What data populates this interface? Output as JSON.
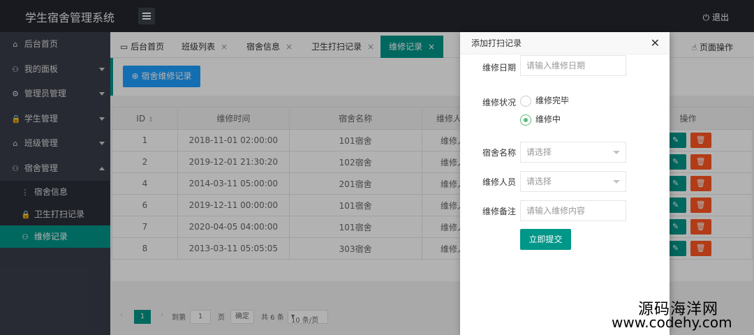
{
  "header": {
    "title": "学生宿舍管理系统",
    "logout": "退出"
  },
  "sidebar": {
    "items": [
      {
        "icon": "⌂",
        "label": "后台首页"
      },
      {
        "icon": "⚇",
        "label": "我的面板"
      },
      {
        "icon": "⚙",
        "label": "管理员管理"
      },
      {
        "icon": "🔒",
        "label": "学生管理"
      },
      {
        "icon": "⌂",
        "label": "班级管理"
      },
      {
        "icon": "⚇",
        "label": "宿舍管理"
      }
    ],
    "subitems": [
      {
        "icon": "⋮",
        "label": "宿舍信息"
      },
      {
        "icon": "🔒",
        "label": "卫生打扫记录"
      },
      {
        "icon": "⚇",
        "label": "维修记录"
      }
    ]
  },
  "tabs": [
    {
      "label": "后台首页"
    },
    {
      "label": "班级列表",
      "close": "×"
    },
    {
      "label": "宿舍信息",
      "close": "×"
    },
    {
      "label": "卫生打扫记录",
      "close": "×"
    },
    {
      "label": "维修记录",
      "close": "×"
    }
  ],
  "page_ops": "页面操作",
  "toolbar": {
    "add_label": "宿舍维修记录"
  },
  "table": {
    "headers": [
      "ID",
      "维修时间",
      "宿舍名称",
      "维修人员",
      "操作"
    ],
    "rows": [
      {
        "id": "1",
        "time": "2018-11-01 02:00:00",
        "dorm": "101宿舍",
        "staff": "维修人"
      },
      {
        "id": "2",
        "time": "2019-12-01 21:30:20",
        "dorm": "102宿舍",
        "staff": "维修人"
      },
      {
        "id": "4",
        "time": "2014-03-11 05:00:00",
        "dorm": "201宿舍",
        "staff": "维修人"
      },
      {
        "id": "6",
        "time": "2019-12-11 00:00:00",
        "dorm": "101宿舍",
        "staff": "维修人"
      },
      {
        "id": "7",
        "time": "2020-04-05 04:00:00",
        "dorm": "101宿舍",
        "staff": "维修人"
      },
      {
        "id": "8",
        "time": "2013-03-11 05:05:05",
        "dorm": "303宿舍",
        "staff": "维修人"
      }
    ]
  },
  "pager": {
    "current": "1",
    "goto": "到第",
    "page_input": "1",
    "page_unit": "页",
    "confirm": "确定",
    "total": "共 6 条",
    "size": "10 条/页"
  },
  "modal": {
    "title": "添加打扫记录",
    "date_label": "维修日期",
    "date_placeholder": "请输入维修日期",
    "status_label": "维修状况",
    "status_options": [
      "维修完毕",
      "维修中"
    ],
    "dorm_label": "宿舍名称",
    "dorm_placeholder": "请选择",
    "staff_label": "维修人员",
    "staff_placeholder": "请选择",
    "note_label": "维修备注",
    "note_placeholder": "请输入维修内容",
    "submit": "立即提交"
  },
  "watermark": {
    "line1": "源码海洋网",
    "line2": "www.codehy.com"
  }
}
